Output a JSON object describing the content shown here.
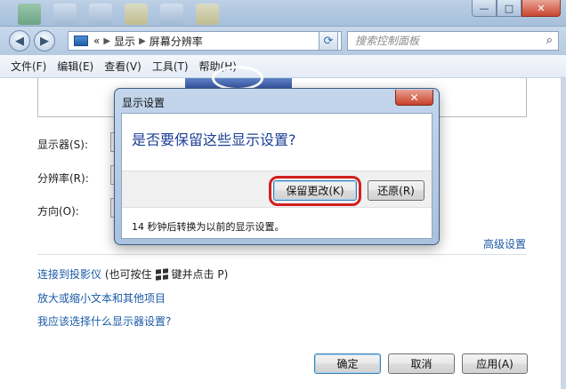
{
  "window": {
    "close_glyph": "✕",
    "minimize_glyph": "—",
    "maximize_glyph": "□"
  },
  "nav": {
    "back_glyph": "◀",
    "forward_glyph": "▶",
    "address_prefix": "«",
    "breadcrumb": [
      "显示",
      "屏幕分辨率"
    ],
    "refresh_glyph": "⟳",
    "search_placeholder": "搜索控制面板",
    "search_glyph": "⌕"
  },
  "menu": {
    "items": [
      "文件(F)",
      "编辑(E)",
      "查看(V)",
      "工具(T)",
      "帮助(H)"
    ]
  },
  "form": {
    "display_label": "显示器(S):",
    "resolution_label": "分辨率(R):",
    "orientation_label": "方向(O):",
    "advanced_link": "高级设置"
  },
  "links": {
    "projector": "连接到投影仪",
    "projector_hint_before": "(也可按住",
    "projector_hint_after": "键并点击 P)",
    "text_size": "放大或缩小文本和其他项目",
    "which_settings": "我应该选择什么显示器设置?"
  },
  "buttons": {
    "ok": "确定",
    "cancel": "取消",
    "apply": "应用(A)"
  },
  "dialog": {
    "title": "显示设置",
    "close_glyph": "✕",
    "question": "是否要保留这些显示设置?",
    "keep_button": "保留更改(K)",
    "revert_button": "还原(R)",
    "countdown_note": "14 秒钟后转换为以前的显示设置。"
  },
  "colors": {
    "link": "#1a5aa6",
    "dialog_question": "#1c3f94",
    "highlight_ring": "#d2201f"
  }
}
